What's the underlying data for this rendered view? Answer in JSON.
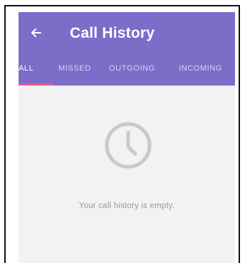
{
  "app_bar": {
    "title": "Call History",
    "back_icon": "arrow-left-icon",
    "background_color": "#7e6cc9"
  },
  "tabs": [
    {
      "label": "ALL",
      "active": true
    },
    {
      "label": "MISSED",
      "active": false
    },
    {
      "label": "OUTGOING",
      "active": false
    },
    {
      "label": "INCOMING",
      "active": false
    }
  ],
  "tab_indicator_color": "#e15a93",
  "empty_state": {
    "icon": "clock-icon",
    "message": "Your call history is empty."
  }
}
